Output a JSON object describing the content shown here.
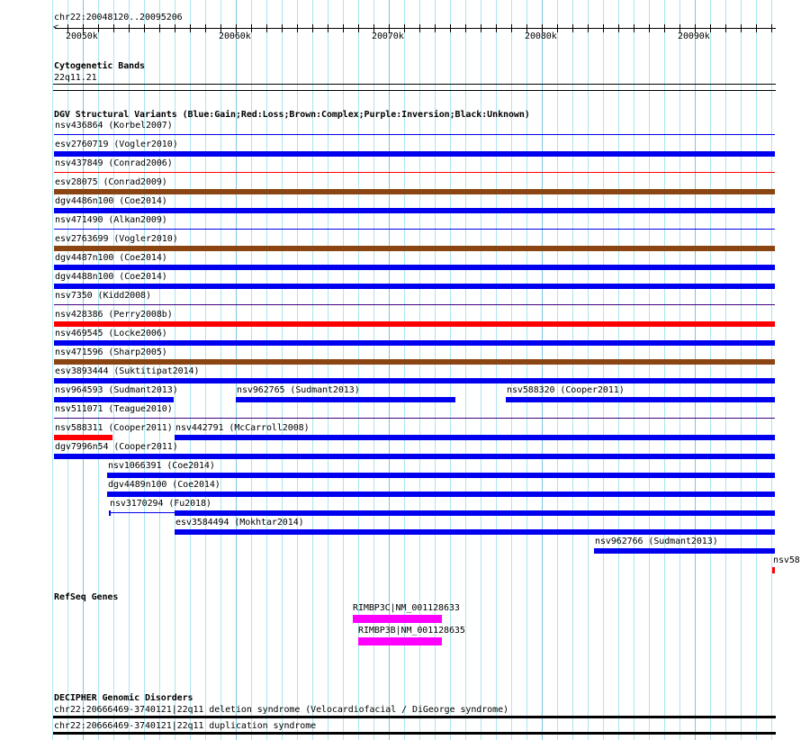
{
  "view": {
    "chrom": "chr22",
    "start": 20048120,
    "end": 20095206,
    "location_label": "chr22:20048120..20095206"
  },
  "ruler": {
    "tick_labels": [
      {
        "label": "20050k",
        "pos": 20050000
      },
      {
        "label": "20060k",
        "pos": 20060000
      },
      {
        "label": "20070k",
        "pos": 20070000
      },
      {
        "label": "20080k",
        "pos": 20080000
      },
      {
        "label": "20090k",
        "pos": 20090000
      }
    ]
  },
  "tracks": {
    "cytobands": {
      "title": "Cytogenetic Bands",
      "band": "22q11.21"
    },
    "dgv": {
      "title": "DGV Structural Variants (Blue:Gain;Red:Loss;Brown:Complex;Purple:Inversion;Black:Unknown)",
      "colors": {
        "gain": "#0000ee",
        "loss": "#ff0000",
        "complex": "#8b4513",
        "inversion": "#400080",
        "unknown": "#000000"
      },
      "rows": [
        [
          {
            "label": "nsv436864 (Korbel2007)",
            "type": "gain",
            "style": "thin",
            "start": 20048120,
            "end": 20095206
          }
        ],
        [
          {
            "label": "esv2760719 (Vogler2010)",
            "type": "gain",
            "style": "thick",
            "start": 20048120,
            "end": 20095206
          }
        ],
        [
          {
            "label": "nsv437849 (Conrad2006)",
            "type": "loss",
            "style": "thin",
            "start": 20048120,
            "end": 20095206
          }
        ],
        [
          {
            "label": "esv28075 (Conrad2009)",
            "type": "complex",
            "style": "thick",
            "start": 20048120,
            "end": 20095206
          }
        ],
        [
          {
            "label": "dgv4486n100 (Coe2014)",
            "type": "gain",
            "style": "thick",
            "start": 20048120,
            "end": 20095206
          }
        ],
        [
          {
            "label": "nsv471490 (Alkan2009)",
            "type": "gain",
            "style": "thin",
            "start": 20048120,
            "end": 20095206
          }
        ],
        [
          {
            "label": "esv2763699 (Vogler2010)",
            "type": "complex",
            "style": "thick",
            "start": 20048120,
            "end": 20095206
          }
        ],
        [
          {
            "label": "dgv4487n100 (Coe2014)",
            "type": "gain",
            "style": "thick",
            "start": 20048120,
            "end": 20095206
          }
        ],
        [
          {
            "label": "dgv4488n100 (Coe2014)",
            "type": "gain",
            "style": "thick",
            "start": 20048120,
            "end": 20095206
          }
        ],
        [
          {
            "label": "nsv7350 (Kidd2008)",
            "type": "inversion",
            "style": "thin",
            "start": 20048120,
            "end": 20095206
          }
        ],
        [
          {
            "label": "nsv428386 (Perry2008b)",
            "type": "loss",
            "style": "thick",
            "start": 20048120,
            "end": 20095206
          }
        ],
        [
          {
            "label": "nsv469545 (Locke2006)",
            "type": "gain",
            "style": "thick",
            "start": 20048120,
            "end": 20095206
          }
        ],
        [
          {
            "label": "nsv471596 (Sharp2005)",
            "type": "complex",
            "style": "thick",
            "start": 20048120,
            "end": 20095206
          }
        ],
        [
          {
            "label": "esv3893444 (Suktitipat2014)",
            "type": "gain",
            "style": "thick",
            "start": 20048120,
            "end": 20095206
          }
        ],
        [
          {
            "label": "nsv964593 (Sudmant2013)",
            "type": "gain",
            "style": "thick",
            "start": 20048120,
            "end": 20055950
          },
          {
            "label": "nsv962765 (Sudmant2013)",
            "type": "gain",
            "style": "thick",
            "start": 20060000,
            "end": 20074350
          },
          {
            "label": "nsv588320 (Cooper2011)",
            "type": "gain",
            "style": "thick",
            "start": 20077650,
            "end": 20095206
          }
        ],
        [
          {
            "label": "nsv511071 (Teague2010)",
            "type": "inversion",
            "style": "thin",
            "start": 20048120,
            "end": 20095206
          }
        ],
        [
          {
            "label": "nsv588311 (Cooper2011)",
            "type": "loss",
            "style": "thick",
            "start": 20048120,
            "end": 20051940
          },
          {
            "label": "nsv442791 (McCarroll2008)",
            "type": "gain",
            "style": "thick",
            "start": 20056000,
            "end": 20095206
          }
        ],
        [
          {
            "label": "dgv7996n54 (Cooper2011)",
            "type": "gain",
            "style": "thick",
            "start": 20048120,
            "end": 20095206
          }
        ],
        [
          {
            "label": "nsv1066391 (Coe2014)",
            "type": "gain",
            "style": "thick",
            "start": 20051590,
            "end": 20095206
          }
        ],
        [
          {
            "label": "dgv4489n100 (Coe2014)",
            "type": "gain",
            "style": "thick",
            "start": 20051590,
            "end": 20095206
          }
        ],
        [
          {
            "label": "nsv3170294 (Fu2018)",
            "type": "gain",
            "style": "split",
            "start": 20051700,
            "thick_start": 20056000,
            "end": 20095206
          }
        ],
        [
          {
            "label": "esv3584494 (Mokhtar2014)",
            "type": "gain",
            "style": "thick",
            "start": 20056000,
            "end": 20095206
          }
        ],
        [
          {
            "label": "nsv962766 (Sudmant2013)",
            "type": "gain",
            "style": "thick",
            "start": 20083410,
            "end": 20095206
          }
        ],
        [
          {
            "label": "nsv58",
            "type": "loss",
            "style": "thick",
            "start": 20095050,
            "end": 20095206
          }
        ]
      ]
    },
    "refseq": {
      "title": "RefSeq Genes",
      "color": "#ff00ff",
      "genes": [
        {
          "label": "RIMBP3C|NM_001128633",
          "start": 20067650,
          "end": 20073470
        },
        {
          "label": "RIMBP3B|NM_001128635",
          "start": 20068000,
          "end": 20073470
        }
      ]
    },
    "decipher": {
      "title": "DECIPHER Genomic Disorders",
      "items": [
        {
          "label": "chr22:20666469-3740121|22q11 deletion syndrome (Velocardiofacial / DiGeorge syndrome)"
        },
        {
          "label": "chr22:20666469-3740121|22q11 duplication syndrome"
        }
      ]
    }
  }
}
